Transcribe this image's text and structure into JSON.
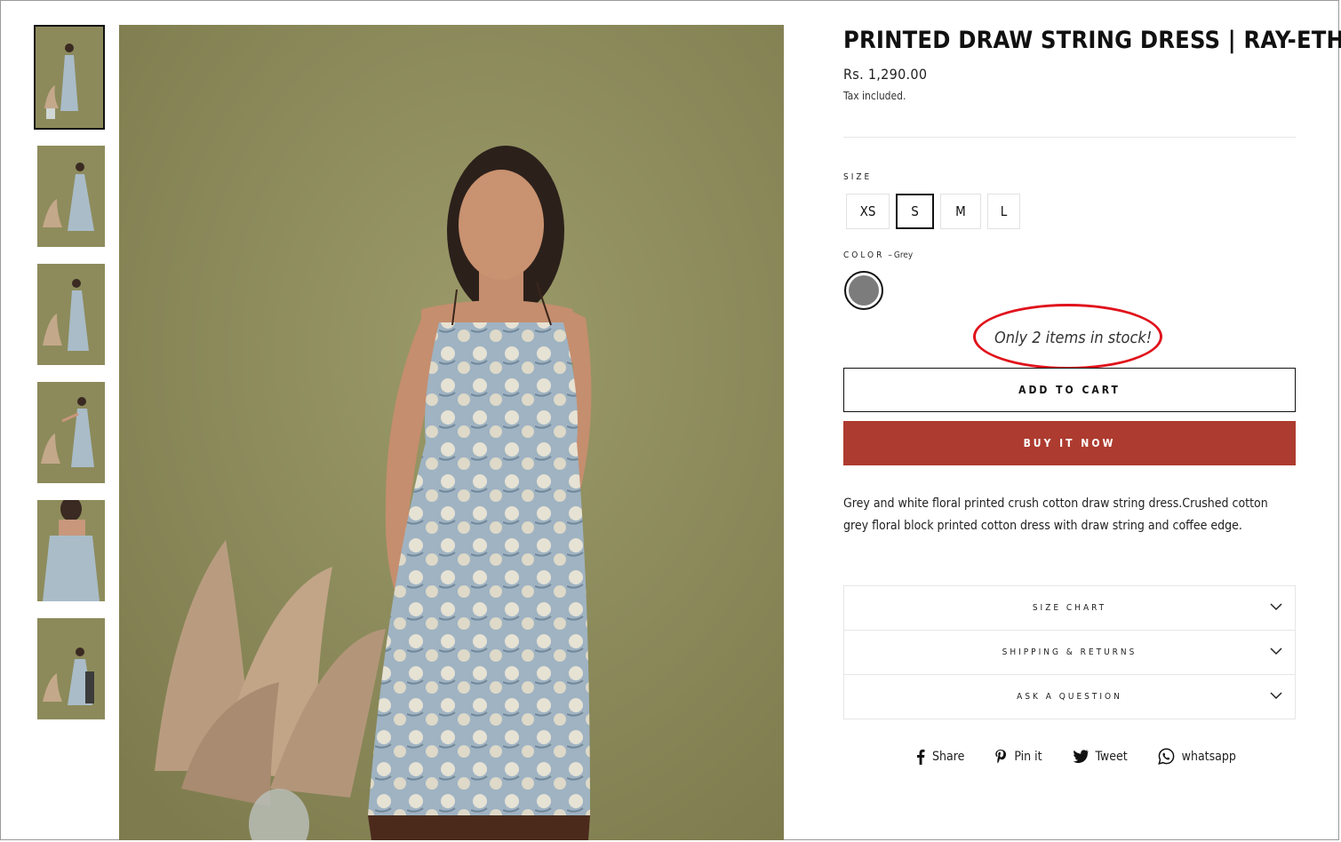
{
  "product": {
    "title": "PRINTED DRAW STRING DRESS | RAY-ETHNIC",
    "price": "Rs. 1,290.00",
    "tax_note": "Tax included."
  },
  "size": {
    "label": "SIZE",
    "options": [
      "XS",
      "S",
      "M",
      "L"
    ],
    "selected": "S"
  },
  "color": {
    "label": "COLOR",
    "separator": "–",
    "value": "Grey",
    "swatch_hex": "#7c7c7c"
  },
  "stock_message": "Only 2 items in stock!",
  "buttons": {
    "add_to_cart": "ADD TO CART",
    "buy_now": "BUY IT NOW"
  },
  "description": "Grey and white floral printed crush cotton draw string dress.Crushed cotton grey floral block printed cotton dress with draw string and coffee edge.",
  "accordion": [
    {
      "label": "SIZE CHART"
    },
    {
      "label": "SHIPPING & RETURNS"
    },
    {
      "label": "ASK A QUESTION"
    }
  ],
  "share": {
    "facebook": "Share",
    "pinterest": "Pin it",
    "twitter": "Tweet",
    "whatsapp": "whatsapp"
  },
  "colors": {
    "buy_button": "#ad3b2f",
    "highlight_ring": "#e0121b",
    "backdrop": "#8e8c5a",
    "dress": "#a9bcc8"
  },
  "gallery": {
    "thumbnail_count": 6,
    "active_thumbnail": 1
  }
}
